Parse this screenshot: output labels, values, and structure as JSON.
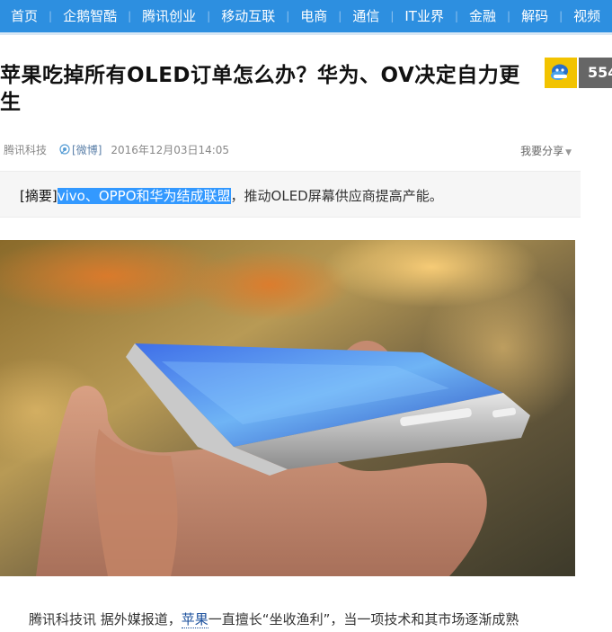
{
  "nav": {
    "items": [
      "首页",
      "企鹅智酷",
      "腾讯创业",
      "移动互联",
      "电商",
      "通信",
      "IT业界",
      "金融",
      "解码",
      "视频"
    ]
  },
  "article": {
    "title": "苹果吃掉所有OLED订单怎么办？华为、OV决定自力更生",
    "source": "腾讯科技",
    "weibo": "[微博]",
    "datetime": "2016年12月03日14:05",
    "share_label": "我要分享",
    "abstract_label": "[摘要]",
    "abstract_highlight": "vivo、OPPO和华为结成联盟",
    "abstract_rest": "，推动OLED屏幕供应商提高产能。",
    "body_prefix": "腾讯科技讯 据外媒报道，",
    "body_link": "苹果",
    "body_suffix": "一直擅长“坐收渔利”，当一项技术和其市场逐渐成熟"
  },
  "sidebar": {
    "count": "554"
  },
  "colors": {
    "nav_bg": "#2d8fe0",
    "highlight": "#3399ff",
    "badge_yellow": "#f2c300"
  }
}
